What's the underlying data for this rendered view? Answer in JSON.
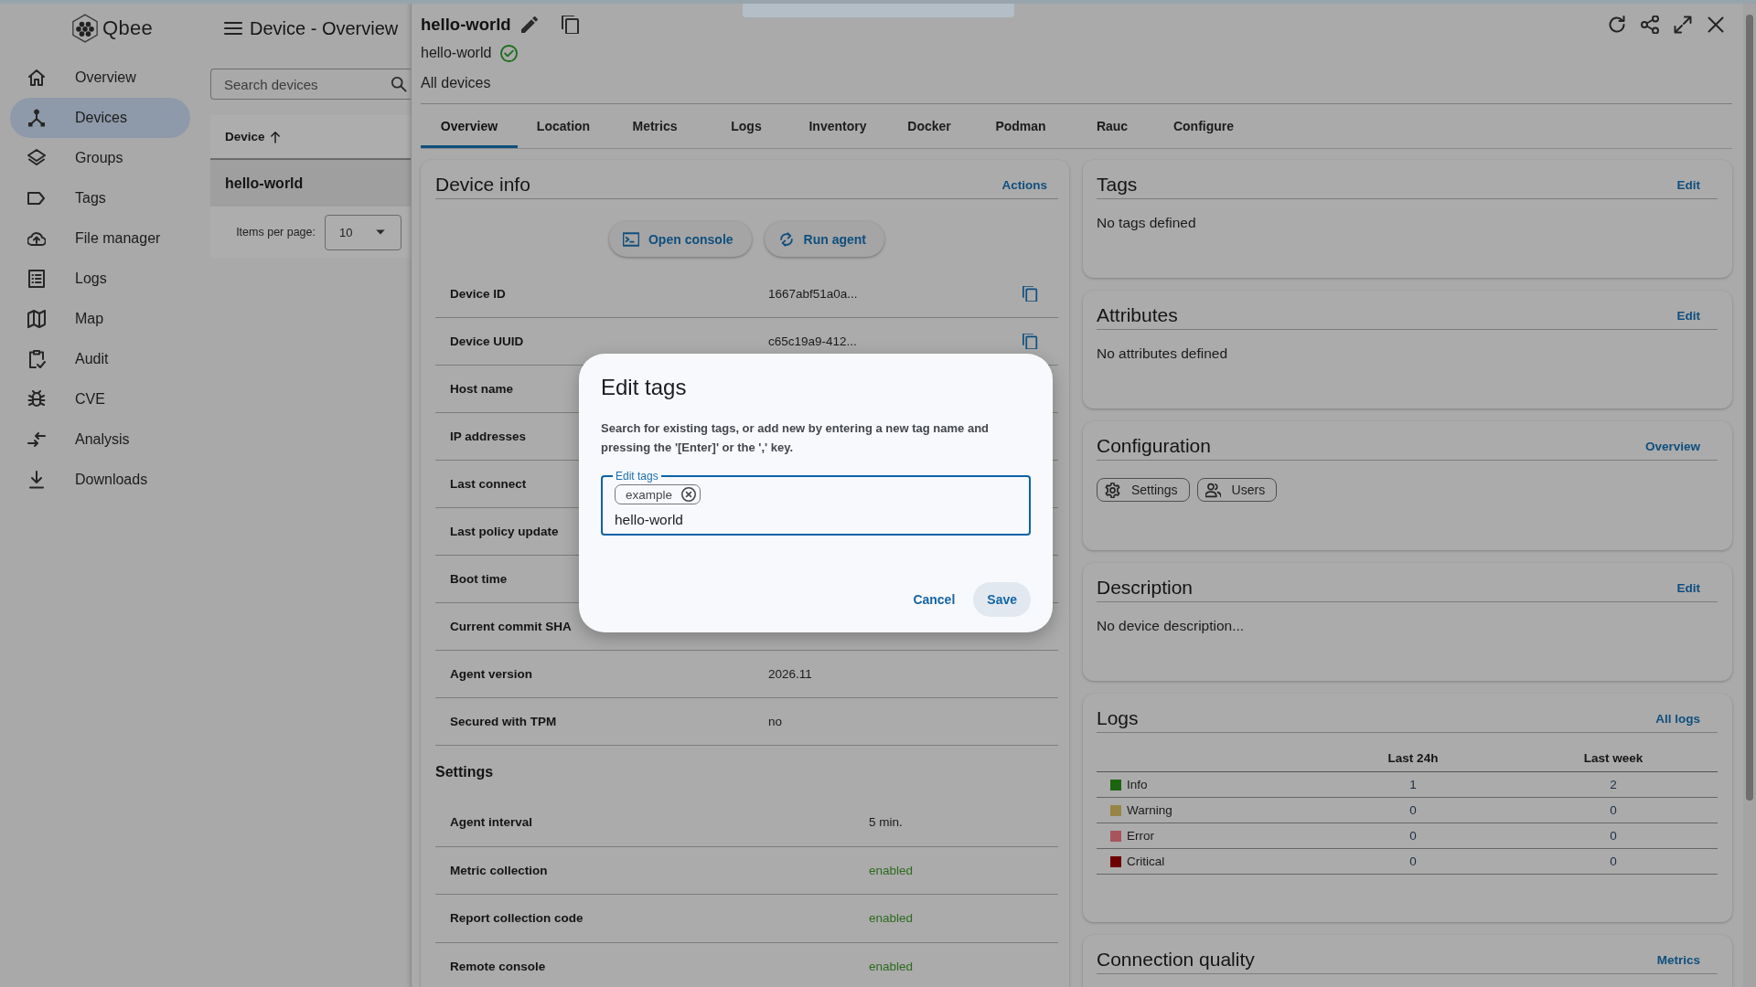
{
  "sidebar": {
    "logo": "Qbee",
    "items": [
      {
        "label": "Overview",
        "selected": false
      },
      {
        "label": "Devices",
        "selected": true
      },
      {
        "label": "Groups",
        "selected": false
      },
      {
        "label": "Tags",
        "selected": false
      },
      {
        "label": "File manager",
        "selected": false
      },
      {
        "label": "Logs",
        "selected": false
      },
      {
        "label": "Map",
        "selected": false
      },
      {
        "label": "Audit",
        "selected": false
      },
      {
        "label": "CVE",
        "selected": false
      },
      {
        "label": "Analysis",
        "selected": false
      },
      {
        "label": "Downloads",
        "selected": false
      }
    ]
  },
  "device_list": {
    "title": "Device - Overview",
    "search": {
      "placeholder": "Search devices"
    },
    "column": {
      "label": "Device",
      "sort_ascending": true
    },
    "rows": [
      {
        "name": "hello-world",
        "selected": true
      }
    ],
    "pagination": {
      "label": "Items per page:",
      "value": "10"
    }
  },
  "device": {
    "title": "hello-world",
    "name": "hello-world",
    "online": true,
    "group": "All devices"
  },
  "tabs": [
    {
      "label": "Overview",
      "selected": true
    },
    {
      "label": "Location",
      "selected": false
    },
    {
      "label": "Metrics",
      "selected": false
    },
    {
      "label": "Logs",
      "selected": false
    },
    {
      "label": "Inventory",
      "selected": false
    },
    {
      "label": "Docker",
      "selected": false
    },
    {
      "label": "Podman",
      "selected": false
    },
    {
      "label": "Rauc",
      "selected": false
    },
    {
      "label": "Configure",
      "selected": false
    }
  ],
  "device_info": {
    "title": "Device info",
    "action": "Actions",
    "buttons": [
      "Open console",
      "Run agent"
    ],
    "rows": [
      {
        "label": "Device ID",
        "value": "1667abf51a0a...",
        "copyable": true
      },
      {
        "label": "Device UUID",
        "value": "c65c19a9-412...",
        "copyable": true
      },
      {
        "label": "Host name"
      },
      {
        "label": "IP addresses"
      },
      {
        "label": "Last connect"
      },
      {
        "label": "Last policy update"
      },
      {
        "label": "Boot time"
      },
      {
        "label": "Current commit SHA"
      },
      {
        "label": "Agent version",
        "value": "2026.11",
        "copyable": false
      },
      {
        "label": "Secured with TPM",
        "value": "no",
        "copyable": false
      }
    ],
    "settings_title": "Settings",
    "settings": [
      {
        "label": "Agent interval",
        "value": "5 min.",
        "kind": "text"
      },
      {
        "label": "Metric collection",
        "value": "enabled",
        "kind": "status"
      },
      {
        "label": "Report collection code",
        "value": "enabled",
        "kind": "status"
      },
      {
        "label": "Remote console",
        "value": "enabled",
        "kind": "status"
      }
    ]
  },
  "cards": [
    {
      "kind": "empty",
      "title": "Tags",
      "action": "Edit",
      "text": "No tags defined"
    },
    {
      "kind": "empty",
      "title": "Attributes",
      "action": "Edit",
      "text": "No attributes defined"
    },
    {
      "kind": "chips",
      "title": "Configuration",
      "action": "Overview",
      "chips": [
        "Settings",
        "Users"
      ]
    },
    {
      "kind": "empty",
      "title": "Description",
      "action": "Edit",
      "text": "No device description..."
    },
    {
      "kind": "table",
      "title": "Logs",
      "action": "All logs",
      "columns": [
        "Last 24h",
        "Last week"
      ],
      "rows": [
        {
          "name": "Info",
          "color": "#1b650f",
          "last_24h": "1",
          "last_week": "2"
        },
        {
          "name": "Warning",
          "color": "#968545",
          "last_24h": "0",
          "last_week": "0"
        },
        {
          "name": "Error",
          "color": "#a5555b",
          "last_24h": "0",
          "last_week": "0"
        },
        {
          "name": "Critical",
          "color": "#6c0000",
          "last_24h": "0",
          "last_week": "0"
        }
      ]
    },
    {
      "kind": "empty",
      "title": "Connection quality",
      "action": "Metrics"
    }
  ],
  "dialog": {
    "title": "Edit tags",
    "text": "Search for existing tags, or add new by entering a new tag name and pressing the '[Enter]' or the ',' key.",
    "field": {
      "label": "Edit tags",
      "chips": [
        "example"
      ],
      "value": "hello-world",
      "focused": true
    },
    "buttons": [
      {
        "label": "Cancel",
        "kind": "text"
      },
      {
        "label": "Save",
        "kind": "tonal"
      }
    ]
  }
}
